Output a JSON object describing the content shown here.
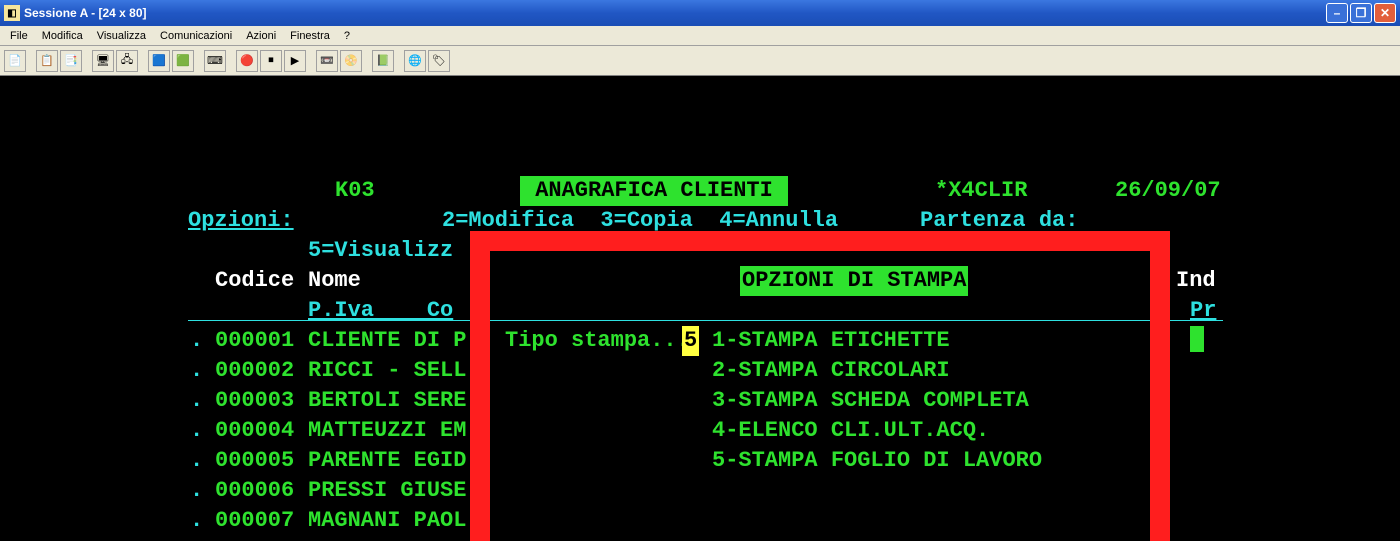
{
  "window": {
    "title": "Sessione A - [24 x 80]",
    "buttons": {
      "min": "–",
      "max": "❐",
      "close": "✕"
    }
  },
  "menu": [
    "File",
    "Modifica",
    "Visualizza",
    "Comunicazioni",
    "Azioni",
    "Finestra",
    "?"
  ],
  "terminal": {
    "screen_code": "K03",
    "header_title": " ANAGRAFICA CLIENTI ",
    "program_id": "*X4CLIR",
    "date": "26/09/07",
    "opzioni_label": "Opzioni:",
    "opzioni_line": "2=Modifica  3=Copia  4=Annulla",
    "partenza_label": "Partenza da:",
    "opzione5": "5=Visualizz",
    "col_codice": "Codice",
    "col_nome": "Nome",
    "col_ind": "Ind",
    "subhead_piva": "P.Iva    Co",
    "subhead_pr": "Pr",
    "rows": [
      {
        "code": "000001",
        "name": "CLIENTE DI P"
      },
      {
        "code": "000002",
        "name": "RICCI - SELL"
      },
      {
        "code": "000003",
        "name": "BERTOLI SERE"
      },
      {
        "code": "000004",
        "name": "MATTEUZZI EM"
      },
      {
        "code": "000005",
        "name": "PARENTE EGID"
      },
      {
        "code": "000006",
        "name": "PRESSI GIUSE"
      },
      {
        "code": "000007",
        "name": "MAGNANI PAOL"
      }
    ],
    "popup": {
      "title": "OPZIONI DI STAMPA",
      "field_label": "Tipo stampa...:",
      "field_value": "5",
      "options": [
        "1-STAMPA ETICHETTE",
        "2-STAMPA CIRCOLARI",
        "3-STAMPA SCHEDA COMPLETA",
        "4-ELENCO CLI.ULT.ACQ.",
        "5-STAMPA FOGLIO DI LAVORO"
      ]
    }
  },
  "colors": {
    "titlebar": "#2157c4",
    "term_green": "#2ee22e",
    "term_cyan": "#2ee0e0",
    "term_red": "#ff1e1e",
    "term_yellow": "#ffff40"
  }
}
